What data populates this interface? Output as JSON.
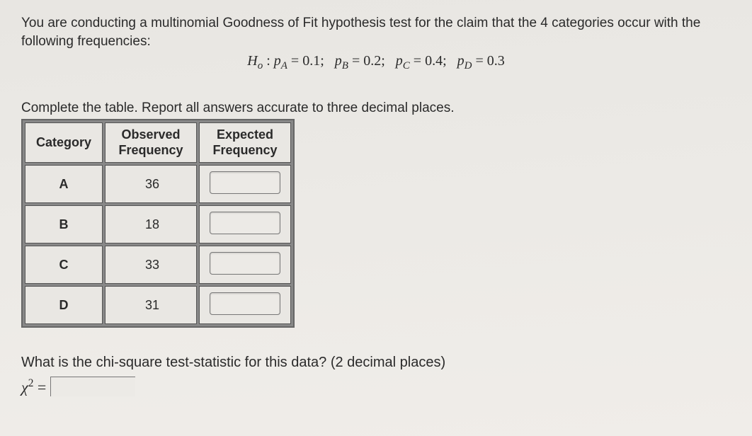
{
  "intro": "You are conducting a multinomial Goodness of Fit hypothesis test for the claim that the 4 categories occur with the following frequencies:",
  "hypothesis": {
    "lead": "H",
    "sub": "o",
    "pA_lhs": "p",
    "pA_sub": "A",
    "pA_val": "0.1",
    "pB_lhs": "p",
    "pB_sub": "B",
    "pB_val": "0.2",
    "pC_lhs": "p",
    "pC_sub": "C",
    "pC_val": "0.4",
    "pD_lhs": "p",
    "pD_sub": "D",
    "pD_val": "0.3"
  },
  "instruction": "Complete the table. Report all answers accurate to three decimal places.",
  "table": {
    "headers": {
      "category": "Category",
      "observed_l1": "Observed",
      "observed_l2": "Frequency",
      "expected_l1": "Expected",
      "expected_l2": "Frequency"
    },
    "rows": [
      {
        "category": "A",
        "observed": "36"
      },
      {
        "category": "B",
        "observed": "18"
      },
      {
        "category": "C",
        "observed": "33"
      },
      {
        "category": "D",
        "observed": "31"
      }
    ]
  },
  "question2": "What is the chi-square test-statistic for this data? (2 decimal places)",
  "chi": {
    "sym": "χ",
    "sup": "2",
    "eq": "="
  }
}
